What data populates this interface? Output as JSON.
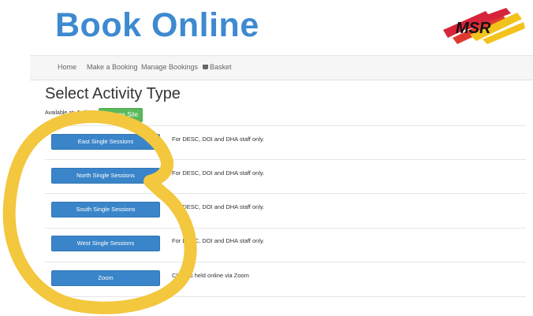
{
  "header": {
    "title": "Book Online",
    "logo_text": "MSR"
  },
  "nav": {
    "items": [
      {
        "label": "Home"
      },
      {
        "label": "Make a Booking"
      },
      {
        "label": "Manage Bookings"
      },
      {
        "label": "Basket",
        "icon": "basket-icon"
      }
    ]
  },
  "page": {
    "heading": "Select Activity Type",
    "available_label": "Available at:",
    "available_site": "Activ8",
    "change_site_label": "Change Site"
  },
  "activities": [
    {
      "label": "East Single Sessions",
      "description": "For DESC, DOI and DHA staff only."
    },
    {
      "label": "North Single Sessions",
      "description": "For DESC, DOI and DHA staff only."
    },
    {
      "label": "South Single Sessions",
      "description": "For DESC, DOI and DHA staff only."
    },
    {
      "label": "West Single Sessions",
      "description": "For DESC, DOI and DHA staff only."
    },
    {
      "label": "Zoom",
      "description": "Classes held online via Zoom"
    }
  ],
  "colors": {
    "brand_blue": "#3d8ad0",
    "button_blue": "#3a85c9",
    "button_green": "#5cb85c",
    "highlight_yellow": "#f3c73e"
  }
}
